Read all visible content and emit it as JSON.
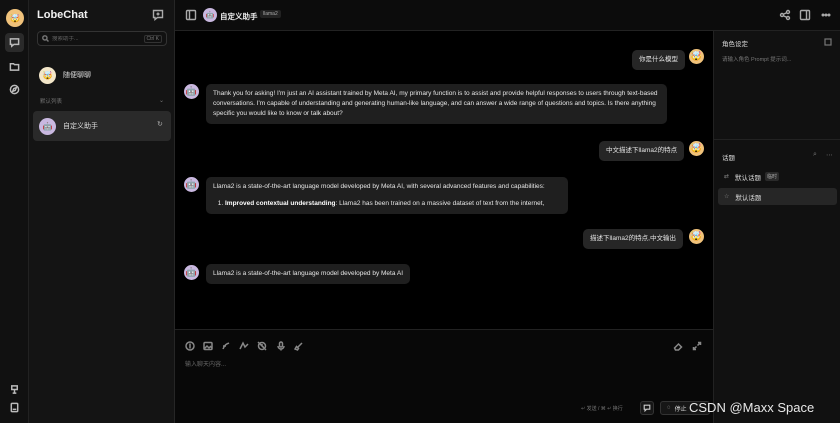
{
  "app": {
    "name": "LobeChat"
  },
  "sidebar": {
    "search_placeholder": "搜索助手...",
    "search_shortcut": "Ctrl K",
    "random_chat_label": "随便聊聊",
    "group_title": "默认列表",
    "sessions": [
      {
        "label": "自定义助手"
      }
    ]
  },
  "header": {
    "title": "自定义助手",
    "model": "llama2"
  },
  "messages": [
    {
      "role": "user",
      "text": "你是什么模型"
    },
    {
      "role": "assistant",
      "text": "Thank you for asking! I'm just an AI assistant trained by Meta AI, my primary function is to assist and provide helpful responses to users through text-based conversations. I'm capable of understanding and generating human-like language, and can answer a wide range of questions and topics. Is there anything specific you would like to know or talk about?"
    },
    {
      "role": "user",
      "text": "中文描述下llama2的特点"
    },
    {
      "role": "assistant",
      "text": "Llama2 is a state-of-the-art language model developed by Meta AI, with several advanced features and capabilities:",
      "list_bold": "Improved contextual understanding",
      "list_rest": ": Llama2 has been trained on a massive dataset of text from the internet,"
    },
    {
      "role": "user",
      "text": "描述下llama2的特点,中文输出"
    },
    {
      "role": "assistant",
      "text": "Llama2 is a state-of-the-art language model developed by Meta AI"
    }
  ],
  "composer": {
    "placeholder": "输入聊天内容...",
    "hint": "↵ 发送 / ⌘ ↵ 换行",
    "stop_label": "停止"
  },
  "right_panel": {
    "role_title": "角色设定",
    "role_placeholder": "请输入角色 Prompt 提示词...",
    "topics_title": "话题",
    "topics": [
      {
        "label": "默认话题",
        "badge": "临时"
      },
      {
        "label": "默认话题"
      }
    ]
  },
  "watermark": "CSDN @Maxx Space"
}
